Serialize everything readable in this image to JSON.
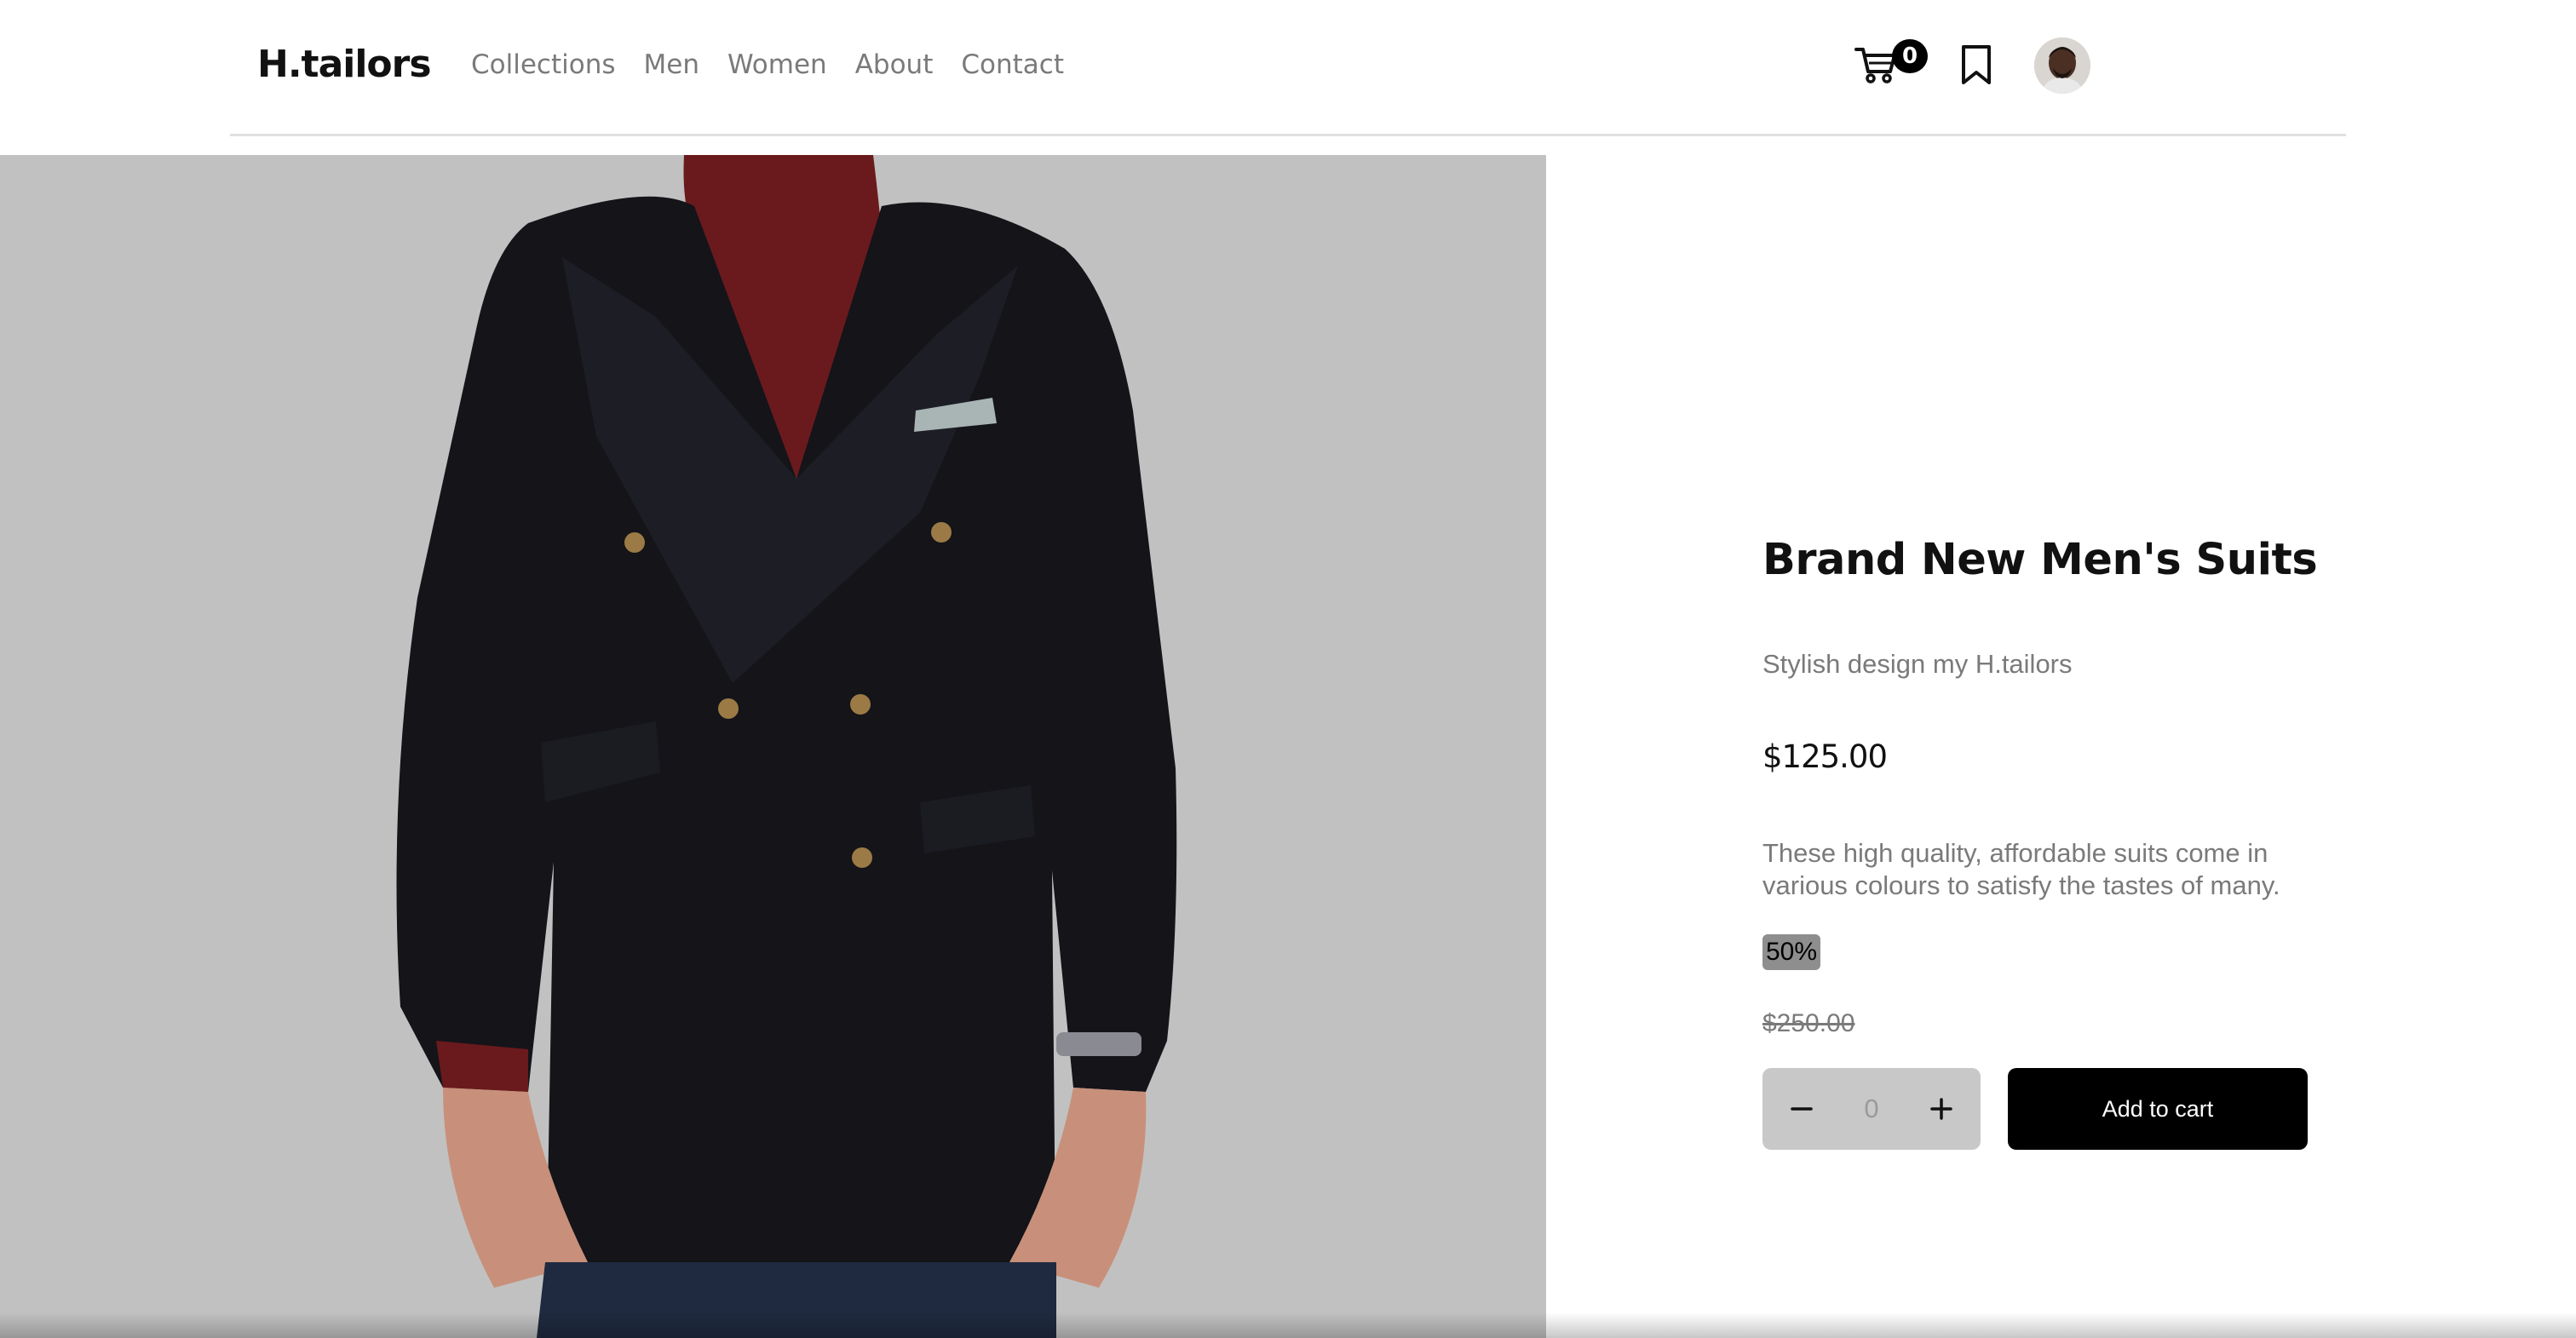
{
  "brand": {
    "logo": "H.tailors"
  },
  "nav": {
    "items": [
      {
        "label": "Collections"
      },
      {
        "label": "Men"
      },
      {
        "label": "Women"
      },
      {
        "label": "About"
      },
      {
        "label": "Contact"
      }
    ]
  },
  "header": {
    "cart_count": "0",
    "icons": [
      "cart-icon",
      "bookmark-icon",
      "avatar"
    ]
  },
  "product": {
    "image": "man-in-double-breasted-navy-suit-with-burgundy-turtleneck",
    "title": "Brand New Men's Suits",
    "subtitle": "Stylish design my H.tailors",
    "price": "$125.00",
    "description": "These high quality, affordable suits come in various colours to satisfy the tastes of many.",
    "discount": "50%",
    "old_price": "$250.00",
    "quantity": "0",
    "add_to_cart_label": "Add to cart"
  },
  "colors": {
    "image_background": "#c1c1c1",
    "primary_button": "#000000",
    "muted_text": "#7a7a7a",
    "discount_badge": "#8e8e8e"
  }
}
